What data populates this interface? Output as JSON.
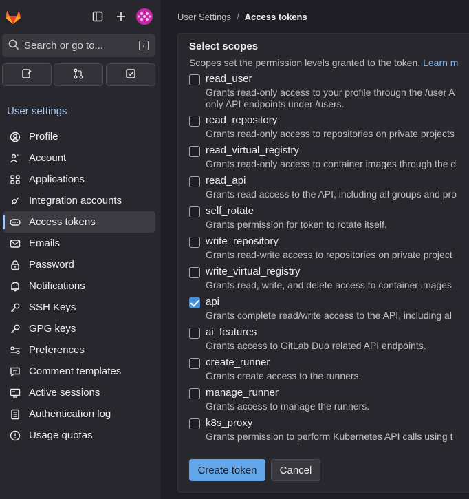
{
  "topbar": {
    "logo": "gitlab-logo",
    "icons": [
      "sidebar-toggle-icon",
      "plus-icon"
    ],
    "avatar": "user-avatar"
  },
  "search": {
    "placeholder": "Search or go to...",
    "shortcut": "/"
  },
  "quick_actions": [
    "issues-icon",
    "merge-requests-icon",
    "todos-icon"
  ],
  "sidebar": {
    "section_title": "User settings",
    "items": [
      {
        "label": "Profile",
        "icon": "profile-icon"
      },
      {
        "label": "Account",
        "icon": "account-icon"
      },
      {
        "label": "Applications",
        "icon": "applications-icon"
      },
      {
        "label": "Integration accounts",
        "icon": "integration-icon"
      },
      {
        "label": "Access tokens",
        "icon": "token-icon",
        "active": true
      },
      {
        "label": "Emails",
        "icon": "mail-icon"
      },
      {
        "label": "Password",
        "icon": "lock-icon"
      },
      {
        "label": "Notifications",
        "icon": "bell-icon"
      },
      {
        "label": "SSH Keys",
        "icon": "key-icon"
      },
      {
        "label": "GPG keys",
        "icon": "key-icon"
      },
      {
        "label": "Preferences",
        "icon": "preferences-icon"
      },
      {
        "label": "Comment templates",
        "icon": "comment-icon"
      },
      {
        "label": "Active sessions",
        "icon": "monitor-icon"
      },
      {
        "label": "Authentication log",
        "icon": "log-icon"
      },
      {
        "label": "Usage quotas",
        "icon": "quota-icon"
      }
    ]
  },
  "breadcrumb": {
    "parent": "User Settings",
    "separator": "/",
    "current": "Access tokens"
  },
  "scopes": {
    "title": "Select scopes",
    "help_text": "Scopes set the permission levels granted to the token.",
    "help_link": "Learn m",
    "items": [
      {
        "name": "read_user",
        "desc": "Grants read-only access to your profile through the /user A",
        "desc2": "only API endpoints under /users.",
        "checked": false
      },
      {
        "name": "read_repository",
        "desc": "Grants read-only access to repositories on private projects",
        "checked": false
      },
      {
        "name": "read_virtual_registry",
        "desc": "Grants read-only access to container images through the d",
        "checked": false
      },
      {
        "name": "read_api",
        "desc": "Grants read access to the API, including all groups and pro",
        "checked": false
      },
      {
        "name": "self_rotate",
        "desc": "Grants permission for token to rotate itself.",
        "checked": false
      },
      {
        "name": "write_repository",
        "desc": "Grants read-write access to repositories on private project",
        "checked": false
      },
      {
        "name": "write_virtual_registry",
        "desc": "Grants read, write, and delete access to container images",
        "checked": false
      },
      {
        "name": "api",
        "desc": "Grants complete read/write access to the API, including al",
        "checked": true
      },
      {
        "name": "ai_features",
        "desc": "Grants access to GitLab Duo related API endpoints.",
        "checked": false
      },
      {
        "name": "create_runner",
        "desc": "Grants create access to the runners.",
        "checked": false
      },
      {
        "name": "manage_runner",
        "desc": "Grants access to manage the runners.",
        "checked": false
      },
      {
        "name": "k8s_proxy",
        "desc": "Grants permission to perform Kubernetes API calls using t",
        "checked": false
      }
    ]
  },
  "buttons": {
    "create": "Create token",
    "cancel": "Cancel"
  },
  "colors": {
    "accent": "#63a6e9",
    "sidebar_bg": "#28272d",
    "page_bg": "#1f1e24"
  }
}
